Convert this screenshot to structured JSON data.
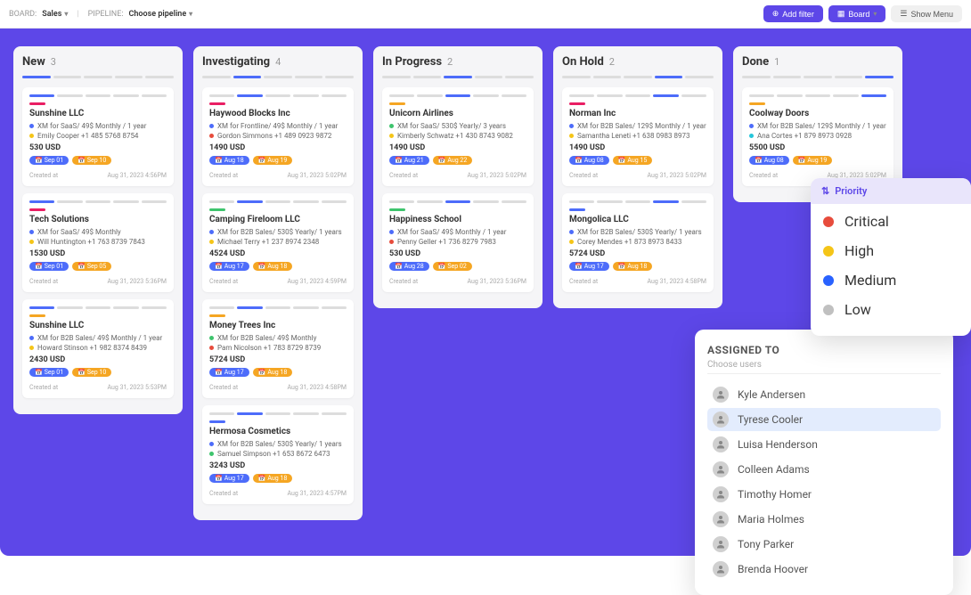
{
  "topbar": {
    "board_label": "BOARD:",
    "board_value": "Sales",
    "pipeline_label": "PIPELINE:",
    "pipeline_value": "Choose pipeline",
    "add_filter": "Add filter",
    "board_btn": "Board",
    "show_menu": "Show Menu"
  },
  "columns": [
    {
      "title": "New",
      "count": 3,
      "cards": [
        {
          "stripe": "magenta",
          "title": "Sunshine LLC",
          "line1_dot": "blue",
          "line1": "XM for SaaS/ 49$ Monthly / 1 year",
          "line2_dot": "yellow",
          "line2": "Emily Cooper +1 485 5768 8754",
          "price": "530 USD",
          "tag1": "Sep 01",
          "tag2": "Sep 10",
          "created": "Created at",
          "date": "Aug 31, 2023 4:56PM"
        },
        {
          "stripe": "magenta",
          "title": "Tech Solutions",
          "line1_dot": "blue",
          "line1": "XM for SaaS/ 49$ Monthly",
          "line2_dot": "yellow",
          "line2": "Will Huntington +1 763 8739 7843",
          "price": "1530 USD",
          "tag1": "Sep 01",
          "tag2": "Sep 05",
          "created": "Created at",
          "date": "Aug 31, 2023 5:36PM"
        },
        {
          "stripe": "orange",
          "title": "Sunshine LLC",
          "line1_dot": "blue",
          "line1": "XM for B2B Sales/ 49$ Monthly / 1 year",
          "line2_dot": "yellow",
          "line2": "Howard Stinson +1 982 8374 8439",
          "price": "2430 USD",
          "tag1": "Sep 01",
          "tag2": "Sep 10",
          "created": "Created at",
          "date": "Aug 31, 2023 5:53PM"
        }
      ]
    },
    {
      "title": "Investigating",
      "count": 4,
      "cards": [
        {
          "stripe": "magenta",
          "title": "Haywood Blocks Inc",
          "line1_dot": "blue",
          "line1": "XM for Frontline/ 49$ Monthly / 1 year",
          "line2_dot": "red",
          "line2": "Gordon Simmons +1 489 0923 9872",
          "price": "1490 USD",
          "tag1": "Aug 18",
          "tag2": "Aug 19",
          "created": "Created at",
          "date": "Aug 31, 2023 5:02PM"
        },
        {
          "stripe": "green",
          "title": "Camping Fireloom LLC",
          "line1_dot": "blue",
          "line1": "XM for B2B Sales/ 530$ Yearly/ 1 years",
          "line2_dot": "yellow",
          "line2": "Michael Terry +1 237 8974 2348",
          "price": "4524 USD",
          "tag1": "Aug 17",
          "tag2": "Aug 18",
          "created": "Created at",
          "date": "Aug 31, 2023 4:59PM"
        },
        {
          "stripe": "orange",
          "title": "Money Trees Inc",
          "line1_dot": "green",
          "line1": "XM for B2B Sales/ 49$ Monthly",
          "line2_dot": "red",
          "line2": "Pam Nicolson +1 783 8729 8739",
          "price": "5724 USD",
          "tag1": "Aug 17",
          "tag2": "Aug 18",
          "created": "Created at",
          "date": "Aug 31, 2023 4:58PM"
        },
        {
          "stripe": "blue",
          "title": "Hermosa Cosmetics",
          "line1_dot": "blue",
          "line1": "XM for B2B Sales/ 530$ Yearly/ 1 years",
          "line2_dot": "green",
          "line2": "Samuel Simpson +1 653 8672 6473",
          "price": "3243 USD",
          "tag1": "Aug 17",
          "tag2": "Aug 18",
          "created": "Created at",
          "date": "Aug 31, 2023 4:57PM"
        }
      ]
    },
    {
      "title": "In Progress",
      "count": 2,
      "cards": [
        {
          "stripe": "orange",
          "title": "Unicorn Airlines",
          "line1_dot": "green",
          "line1": "XM for SaaS/ 530$ Yearly/ 3 years",
          "line2_dot": "yellow",
          "line2": "Kimberly Schwatz +1 430 8743 9082",
          "price": "1490 USD",
          "tag1": "Aug 21",
          "tag2": "Aug 22",
          "created": "Created at",
          "date": "Aug 31, 2023 5:02PM"
        },
        {
          "stripe": "green",
          "title": "Happiness School",
          "line1_dot": "blue",
          "line1": "XM for SaaS/ 49$ Monthly / 1 year",
          "line2_dot": "red",
          "line2": "Penny Geller +1 736 8279 7983",
          "price": "530 USD",
          "tag1": "Aug 28",
          "tag2": "Sep 02",
          "created": "Created at",
          "date": "Aug 31, 2023 5:36PM"
        }
      ]
    },
    {
      "title": "On Hold",
      "count": 2,
      "cards": [
        {
          "stripe": "magenta",
          "title": "Norman Inc",
          "line1_dot": "blue",
          "line1": "XM for B2B Sales/ 129$ Monthly / 1 year",
          "line2_dot": "yellow",
          "line2": "Samantha Leneti +1 638 0983 8973",
          "price": "1490 USD",
          "tag1": "Aug 08",
          "tag2": "Aug 15",
          "created": "Created at",
          "date": "Aug 31, 2023 5:02PM"
        },
        {
          "stripe": "blue",
          "title": "Mongolica LLC",
          "line1_dot": "blue",
          "line1": "XM for B2B Sales/ 530$ Yearly/ 1 years",
          "line2_dot": "yellow",
          "line2": "Corey Mendes +1 873 8973 8433",
          "price": "5724 USD",
          "tag1": "Aug 17",
          "tag2": "Aug 18",
          "created": "Created at",
          "date": "Aug 31, 2023 4:58PM"
        }
      ]
    },
    {
      "title": "Done",
      "count": 1,
      "cards": [
        {
          "stripe": "orange",
          "title": "Coolway Doors",
          "line1_dot": "blue",
          "line1": "XM for B2B Sales/ 129$ Monthly / 1 year",
          "line2_dot": "cyan",
          "line2": "Ana Cortes +1 879 8973 0928",
          "price": "5500 USD",
          "tag1": "Aug 08",
          "tag2": "Aug 19",
          "created": "Created at",
          "date": "Aug 31, 2023 5:02PM"
        }
      ]
    }
  ],
  "assigned": {
    "title": "ASSIGNED TO",
    "subtitle": "Choose users",
    "users": [
      {
        "name": "Kyle Andersen",
        "sel": false
      },
      {
        "name": "Tyrese Cooler",
        "sel": true
      },
      {
        "name": "Luisa Henderson",
        "sel": false
      },
      {
        "name": "Colleen Adams",
        "sel": false
      },
      {
        "name": "Timothy Homer",
        "sel": false
      },
      {
        "name": "Maria Holmes",
        "sel": false
      },
      {
        "name": "Tony Parker",
        "sel": false
      },
      {
        "name": "Brenda Hoover",
        "sel": false
      }
    ]
  },
  "priority": {
    "header": "Priority",
    "items": [
      {
        "label": "Critical",
        "cls": "pr-red"
      },
      {
        "label": "High",
        "cls": "pr-yellow"
      },
      {
        "label": "Medium",
        "cls": "pr-blue"
      },
      {
        "label": "Low",
        "cls": "pr-grey"
      }
    ]
  }
}
